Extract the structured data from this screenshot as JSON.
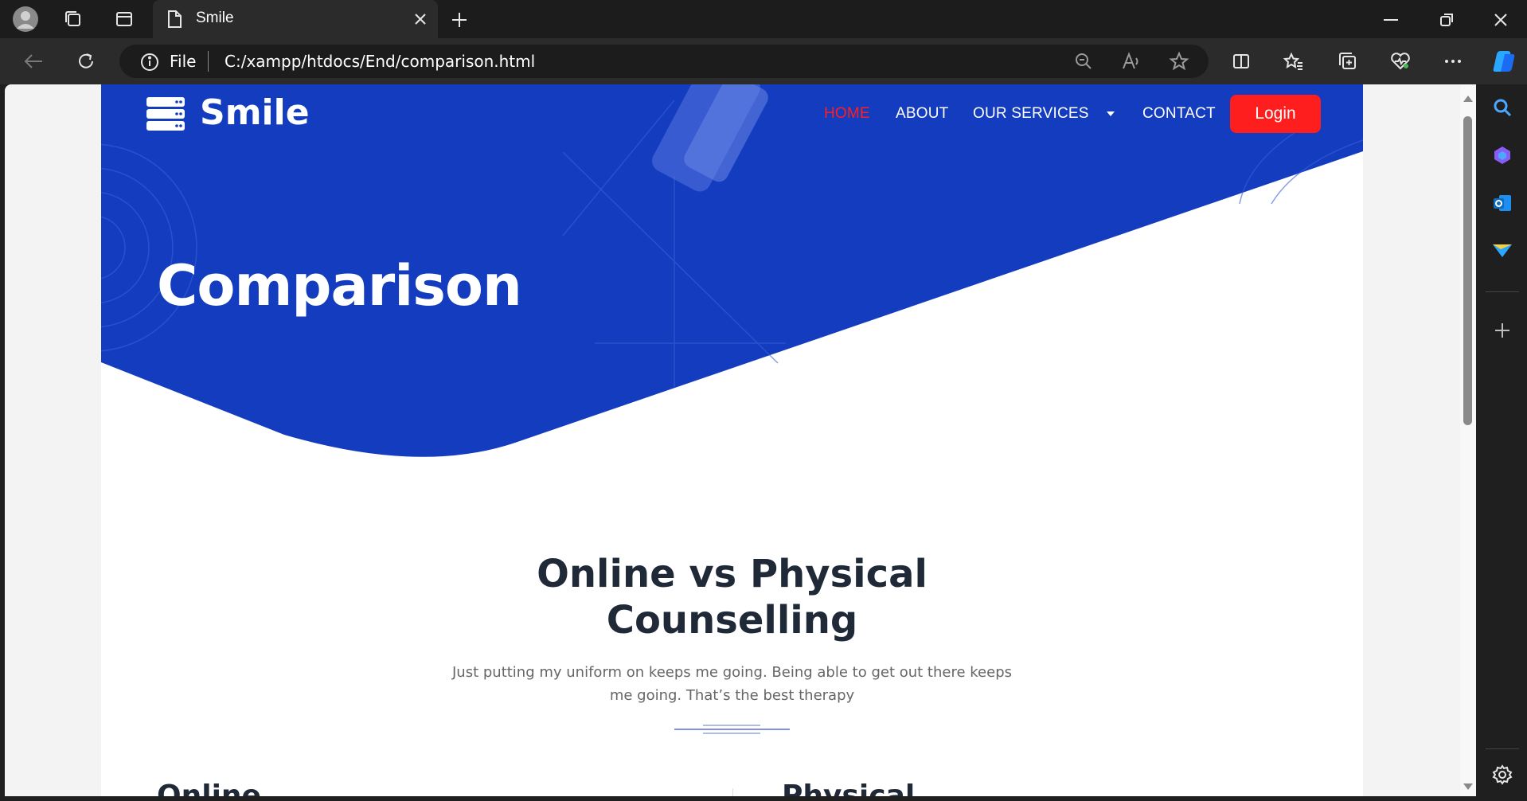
{
  "browser": {
    "tab_title": "Smile",
    "address_scheme": "File",
    "address_url": "C:/xampp/htdocs/End/comparison.html"
  },
  "site": {
    "brand": "Smile",
    "nav": {
      "home": "HOME",
      "about": "ABOUT",
      "services": "OUR SERVICES",
      "contact": "CONTACT"
    },
    "login_label": "Login",
    "hero_title": "Comparison",
    "section_title_line1": "Online vs Physical",
    "section_title_line2": "Counselling",
    "section_subtitle_line1": "Just putting my uniform on keeps me going. Being able to get out there keeps",
    "section_subtitle_line2": "me going. That’s the best therapy",
    "col_left_title": "Online",
    "col_right_title": "Physical"
  },
  "colors": {
    "hero_blue": "#143cbf",
    "accent_red": "#ff1e1e",
    "text_dark": "#1f2937"
  }
}
